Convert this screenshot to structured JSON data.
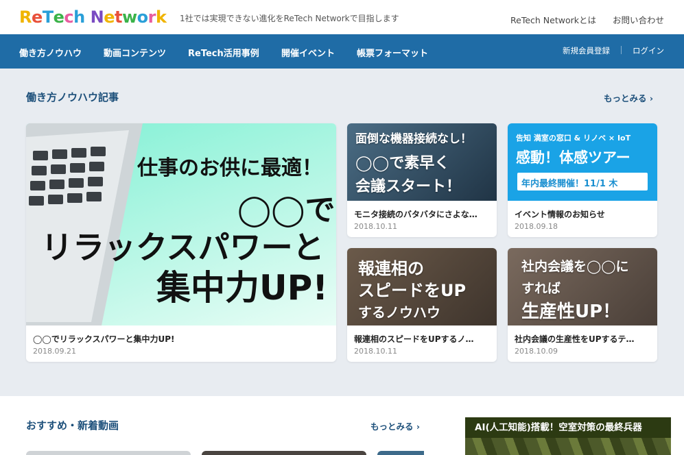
{
  "header": {
    "logo": "ReTech Network",
    "tagline": "1社では実現できない進化をReTech Networkで目指します",
    "links": [
      "ReTech Networkとは",
      "お問い合わせ"
    ]
  },
  "nav": {
    "items": [
      "働き方ノウハウ",
      "動画コンテンツ",
      "ReTech活用事例",
      "開催イベント",
      "帳票フォーマット"
    ],
    "register": "新規会員登録",
    "login": "ログイン"
  },
  "articles": {
    "title": "働き方ノウハウ記事",
    "more": "もっとみる ›",
    "featured": {
      "thumb_lines": [
        "仕事のお供に最適！",
        "◯◯で",
        "リラックスパワーと",
        "集中力UP!"
      ],
      "title": "◯◯でリラックスパワーと集中力UP!",
      "date": "2018.09.21"
    },
    "cards": [
      {
        "thumb_lines": [
          "面倒な機器接続なし！",
          "◯◯で素早く",
          "会議スタート！"
        ],
        "title": "モニタ接続のバタバタにさよな…",
        "date": "2018.10.11"
      },
      {
        "thumb_lines": [
          "告知 満室の窓口 & リノベ × IoT",
          "感動！体感ツアー",
          "年内最終開催！11/1 木"
        ],
        "title": "イベント情報のお知らせ",
        "date": "2018.09.18"
      },
      {
        "thumb_lines": [
          "報連相の",
          "スピードをUP",
          "するノウハウ"
        ],
        "title": "報連相のスピードをUPするノ…",
        "date": "2018.10.11"
      },
      {
        "thumb_lines": [
          "社内会議を◯◯に",
          "すれば",
          "生産性UP！"
        ],
        "title": "社内会議の生産性をUPするテ…",
        "date": "2018.10.09"
      }
    ]
  },
  "videos": {
    "title": "おすすめ・新着動画",
    "more": "もっとみる ›"
  },
  "banner": {
    "text": "AI(人工知能)搭載！空室対策の最終兵器"
  },
  "colors": {
    "nav": "#1f6ca6",
    "accent": "#1c4f7a",
    "section_bg": "#e8ecf1"
  }
}
